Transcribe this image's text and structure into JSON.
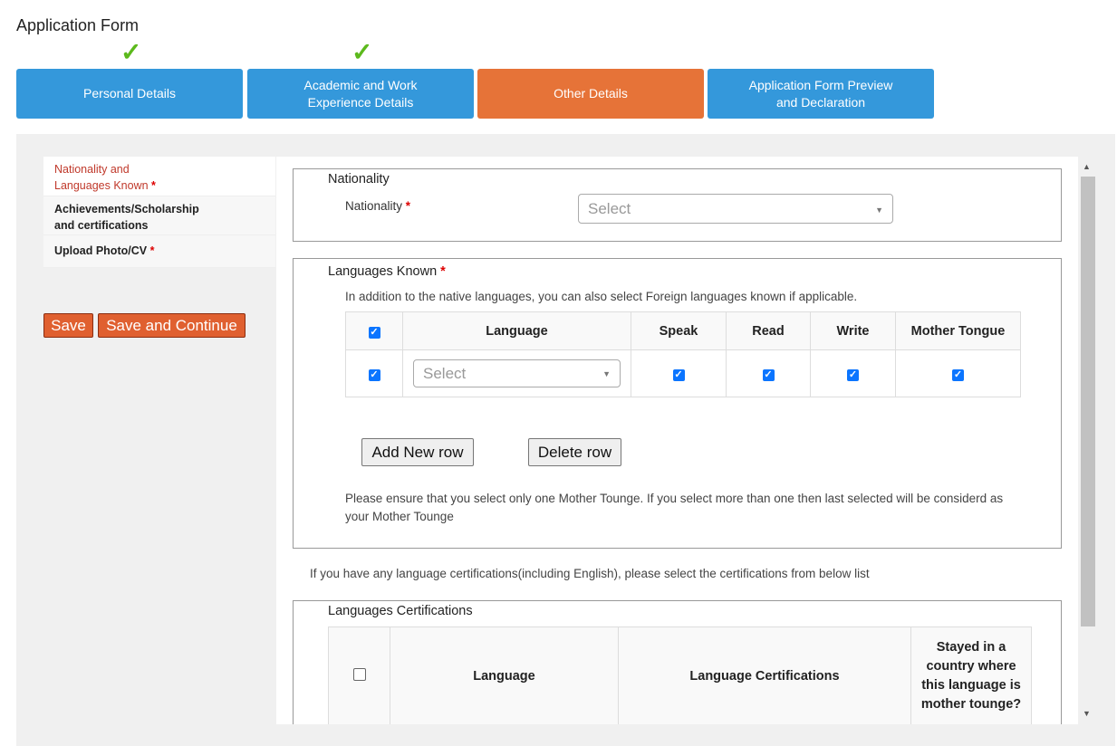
{
  "page": {
    "title": "Application Form"
  },
  "steps": [
    {
      "label": "Personal Details",
      "completed": true,
      "state": "done"
    },
    {
      "label": "Academic and Work\nExperience Details",
      "completed": true,
      "state": "done"
    },
    {
      "label": "Other Details",
      "completed": false,
      "state": "active"
    },
    {
      "label": "Application Form Preview\nand Declaration",
      "completed": false,
      "state": "pending"
    }
  ],
  "check_glyph": "✓",
  "colors": {
    "step_blue": "#3498db",
    "step_active": "#e67338",
    "check": "#5cb91c",
    "save": "#e06030",
    "required": "#dd0000",
    "checkbox": "#0b75ff"
  },
  "sidebar": {
    "items": [
      {
        "label": "Nationality and\nLanguages Known",
        "required": true,
        "active": true
      },
      {
        "label": "Achievements/Scholarship\nand certifications",
        "required": false,
        "active": false
      },
      {
        "label": "Upload Photo/CV",
        "required": true,
        "active": false
      }
    ],
    "required_mark": "*"
  },
  "actions": {
    "save": "Save",
    "save_continue": "Save and Continue"
  },
  "nationality": {
    "section_title": "Nationality",
    "field_label": "Nationality",
    "required_mark": "*",
    "select_value": "Select"
  },
  "languages": {
    "section_title": "Languages Known",
    "required_mark": "*",
    "intro": "In addition to the native languages, you can also select Foreign languages known if applicable.",
    "columns": [
      "Language",
      "Speak",
      "Read",
      "Write",
      "Mother Tongue"
    ],
    "header_checked": true,
    "rows": [
      {
        "selected": true,
        "language": "Select",
        "speak": true,
        "read": true,
        "write": true,
        "mother_tongue": true
      }
    ],
    "add_row": "Add New row",
    "delete_row": "Delete row",
    "note": "Please ensure that you select only one Mother Tounge. If you select more than one then last selected will be considerd as your Mother Tounge"
  },
  "certifications": {
    "intro": "If you have any language certifications(including English), please select the certifications from below list",
    "section_title": "Languages Certifications",
    "header_checked": false,
    "columns": [
      "Language",
      "Language Certifications",
      "Stayed in a country where this language is mother tounge?"
    ]
  },
  "icons": {
    "check": "checkmark-icon",
    "caret": "caret-down-icon",
    "scroll_up": "scroll-up-arrow-icon",
    "scroll_down": "scroll-down-arrow-icon"
  }
}
